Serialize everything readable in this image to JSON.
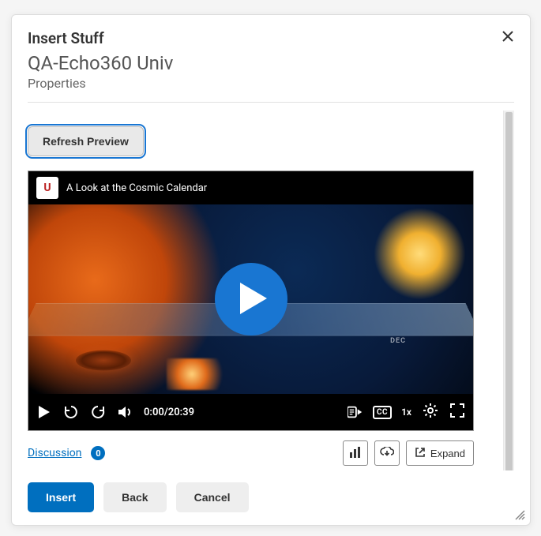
{
  "dialog": {
    "title": "Insert Stuff",
    "subtitle": "QA-Echo360 Univ",
    "section": "Properties"
  },
  "buttons": {
    "refresh": "Refresh Preview",
    "insert": "Insert",
    "back": "Back",
    "cancel": "Cancel",
    "expand": "Expand"
  },
  "player": {
    "badge": "U",
    "title": "A Look at the Cosmic Calendar",
    "time_current": "0:00",
    "time_total": "20:39",
    "speed": "1x",
    "cc": "CC",
    "band_label": "DEC"
  },
  "below": {
    "discussion": "Discussion",
    "count": "0"
  }
}
